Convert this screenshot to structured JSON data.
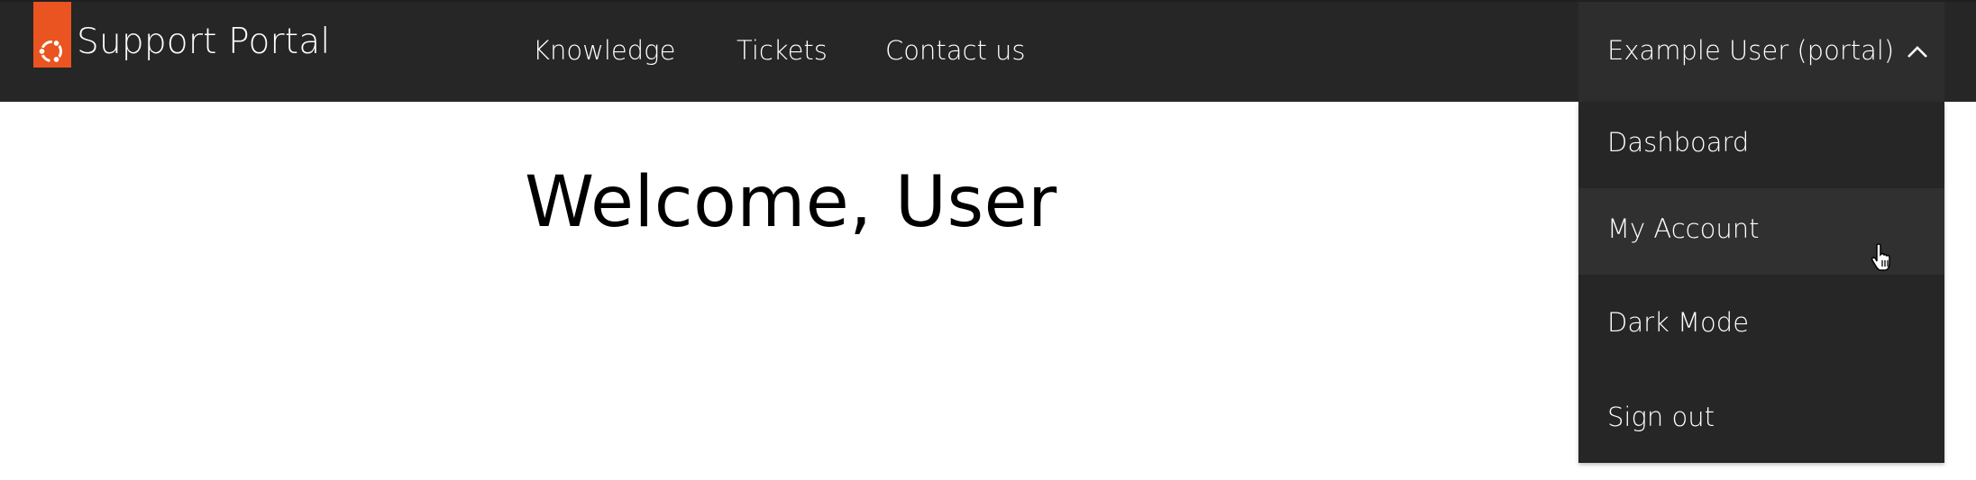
{
  "brand": {
    "name": "Support Portal",
    "logo_icon": "circle-of-friends-icon",
    "accent_color": "#e95420"
  },
  "nav": {
    "links": [
      {
        "label": "Knowledge"
      },
      {
        "label": "Tickets"
      },
      {
        "label": "Contact us"
      }
    ]
  },
  "user_menu": {
    "label": "Example User (portal)",
    "expanded": true,
    "chevron_icon": "chevron-up-icon",
    "items": [
      {
        "label": "Dashboard"
      },
      {
        "label": "My Account",
        "hovered": true
      },
      {
        "label": "Dark Mode"
      },
      {
        "label": "Sign out"
      }
    ]
  },
  "main": {
    "heading": "Welcome, User"
  },
  "colors": {
    "navbar_bg": "#262626",
    "user_button_bg": "#2d2d2d",
    "dropdown_bg": "#262626",
    "hover_bg": "#303030"
  }
}
